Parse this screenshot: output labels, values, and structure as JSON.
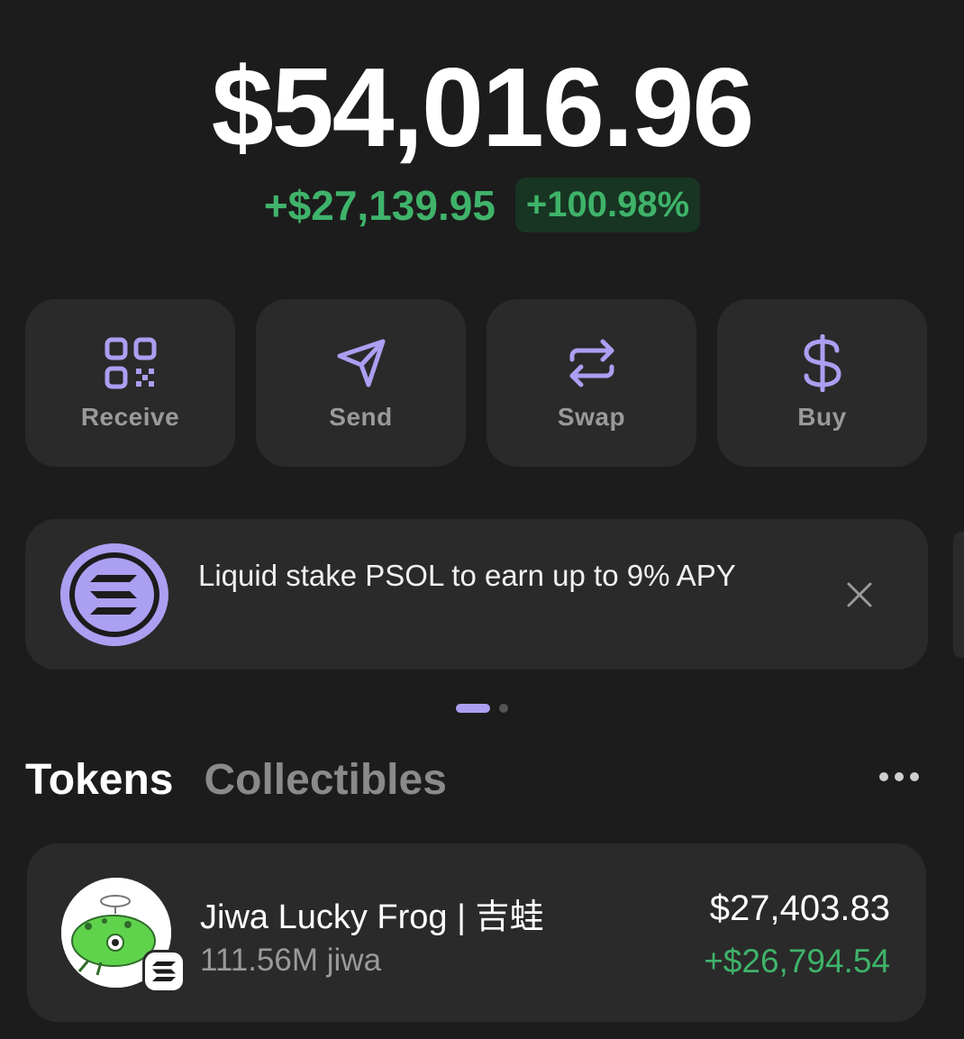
{
  "balance": {
    "total": "$54,016.96",
    "change_amount": "+$27,139.95",
    "change_percent": "+100.98%"
  },
  "actions": [
    {
      "label": "Receive",
      "icon": "qr-code-icon"
    },
    {
      "label": "Send",
      "icon": "paper-plane-icon"
    },
    {
      "label": "Swap",
      "icon": "swap-arrows-icon"
    },
    {
      "label": "Buy",
      "icon": "dollar-icon"
    }
  ],
  "promo": {
    "message": "Liquid stake PSOL to earn up to 9% APY",
    "icon": "solana-logo-icon"
  },
  "carousel": {
    "active_index": 0,
    "count": 2
  },
  "tabs": {
    "tokens": "Tokens",
    "collectibles": "Collectibles",
    "active": "tokens"
  },
  "tokens": [
    {
      "name": "Jiwa Lucky Frog | 吉蛙",
      "amount": "111.56M jiwa",
      "value": "$27,403.83",
      "pnl": "+$26,794.54",
      "icon": "frog-token-icon",
      "chain_icon": "solana-chain-icon"
    }
  ],
  "colors": {
    "background": "#1c1c1c",
    "card": "#2a2a2a",
    "accent": "#ab9ff2",
    "positive": "#3fb36a"
  }
}
